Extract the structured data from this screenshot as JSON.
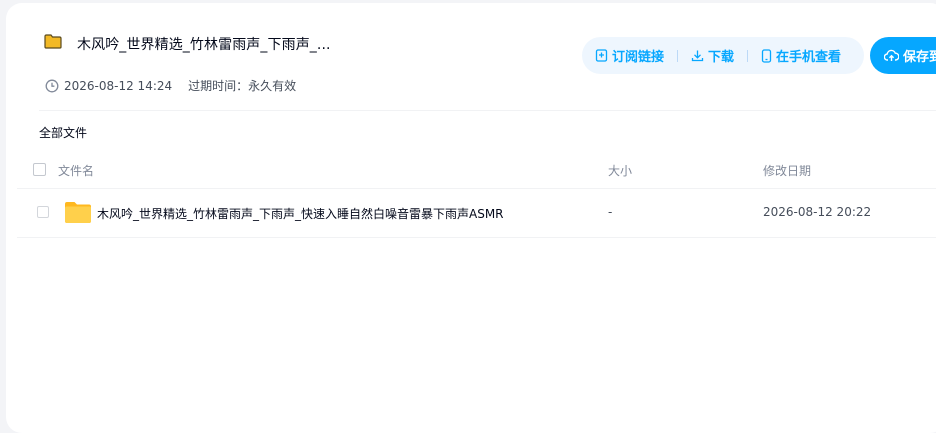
{
  "header": {
    "title": "木风吟_世界精选_竹林雷雨声_下雨声_...",
    "date": "2026-08-12 14:24",
    "expire": "过期时间：永久有效"
  },
  "actions": {
    "subscribe": "订阅链接",
    "download": "下载",
    "mobile": "在手机查看",
    "save": "保存到"
  },
  "breadcrumb": "全部文件",
  "table": {
    "columns": {
      "name": "文件名",
      "size": "大小",
      "modified": "修改日期"
    },
    "rows": [
      {
        "name": "木风吟_世界精选_竹林雷雨声_下雨声_快速入睡自然白噪音雷暴下雨声ASMR",
        "size": "-",
        "modified": "2026-08-12 20:22",
        "icon": "folder-icon"
      }
    ]
  },
  "colors": {
    "accent": "#06a7ff",
    "folder": "#ffc73a"
  }
}
